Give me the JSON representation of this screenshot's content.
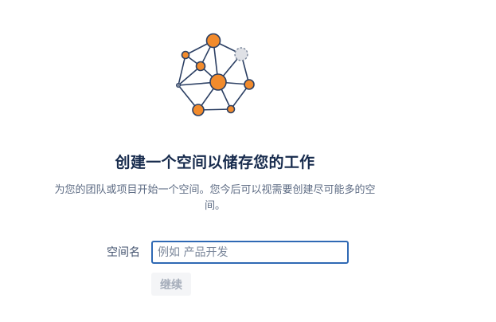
{
  "hero": {
    "icon": "network-nodes-illustration",
    "colors": {
      "node": "#f28b2c",
      "edge": "#2b3f63",
      "dashed_node": "#dfe1e6"
    }
  },
  "main": {
    "title": "创建一个空间以储存您的工作",
    "description_line1": "为您的团队或项目开始一个空间。您今后可以视需要创建尽可能多的空",
    "description_line2": "间。"
  },
  "form": {
    "space_name_label": "空间名",
    "space_name_placeholder": "例如 产品开发",
    "space_name_value": "",
    "continue_label": "继续"
  }
}
